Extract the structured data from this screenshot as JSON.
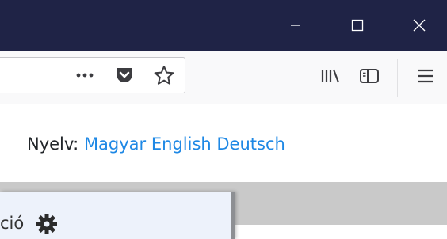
{
  "window_controls": {
    "minimize_icon": "minimize-icon",
    "maximize_icon": "maximize-icon",
    "close_icon": "close-icon"
  },
  "toolbar": {
    "page_actions_icon": "ellipsis-icon",
    "pocket_icon": "pocket-icon",
    "bookmark_icon": "star-icon",
    "library_icon": "library-icon",
    "sidebar_icon": "sidebar-icon",
    "menu_icon": "hamburger-menu-icon"
  },
  "page": {
    "language_label": "Nyelv:",
    "languages": [
      "Magyar",
      "English",
      "Deutsch"
    ],
    "card_text_fragment": "ció",
    "card_icon": "gear-icon"
  },
  "colors": {
    "titlebar": "#1f2346",
    "link": "#1e88e5",
    "card_bg": "#edf2fb",
    "grey_area": "#c9c9c9"
  }
}
